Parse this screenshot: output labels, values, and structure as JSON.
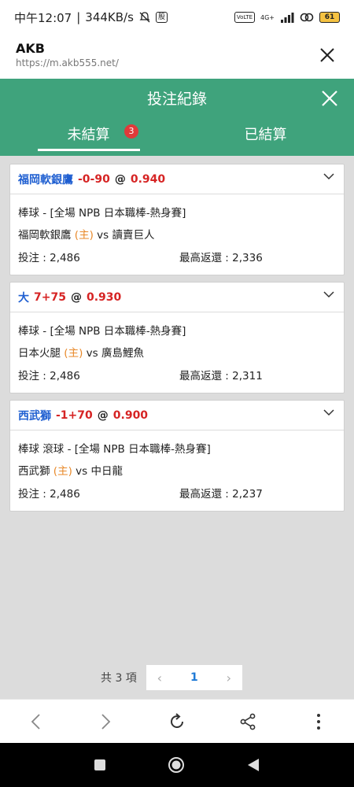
{
  "status_bar": {
    "time": "中午12:07",
    "speed": "344KB/s",
    "app_badge": "股",
    "volte": "VoLTE",
    "network": "4G+",
    "battery": "61"
  },
  "browser": {
    "title": "AKB",
    "url": "https://m.akb555.net/"
  },
  "dialog": {
    "title": "投注紀錄",
    "tabs": [
      {
        "label": "未結算",
        "badge": "3",
        "active": true
      },
      {
        "label": "已結算",
        "active": false
      }
    ]
  },
  "bets": [
    {
      "pick": "福岡軟銀鷹",
      "handicap": "-0-90",
      "at": "@",
      "odds": "0.940",
      "league": "棒球 - [全場 NPB 日本職棒-熱身賽]",
      "home": "福岡軟銀鷹",
      "home_tag": "(主)",
      "vs": "vs",
      "away": "讀賣巨人",
      "stake": "投注 : 2,486",
      "max_return": "最高返還 : 2,336"
    },
    {
      "pick": "大",
      "handicap": "7+75",
      "at": "@",
      "odds": "0.930",
      "league": "棒球 - [全場 NPB 日本職棒-熱身賽]",
      "home": "日本火腿",
      "home_tag": "(主)",
      "vs": "vs",
      "away": "廣島鯉魚",
      "stake": "投注 : 2,486",
      "max_return": "最高返還 : 2,311"
    },
    {
      "pick": "西武獅",
      "handicap": "-1+70",
      "at": "@",
      "odds": "0.900",
      "league": "棒球 滾球 - [全場 NPB 日本職棒-熱身賽]",
      "home": "西武獅",
      "home_tag": "(主)",
      "vs": "vs",
      "away": "中日龍",
      "stake": "投注 : 2,486",
      "max_return": "最高返還 : 2,237"
    }
  ],
  "pagination": {
    "total": "共 3 項",
    "prev": "‹",
    "page": "1",
    "next": "›"
  },
  "toolbar": {
    "icons": [
      "back-icon",
      "forward-icon",
      "reload-icon",
      "share-icon",
      "more-icon"
    ]
  },
  "colors": {
    "accent": "#3fa37c",
    "pick": "#1f5fd1",
    "odds": "#d62424",
    "home_tag": "#e8892a",
    "badge": "#e03a3a"
  }
}
